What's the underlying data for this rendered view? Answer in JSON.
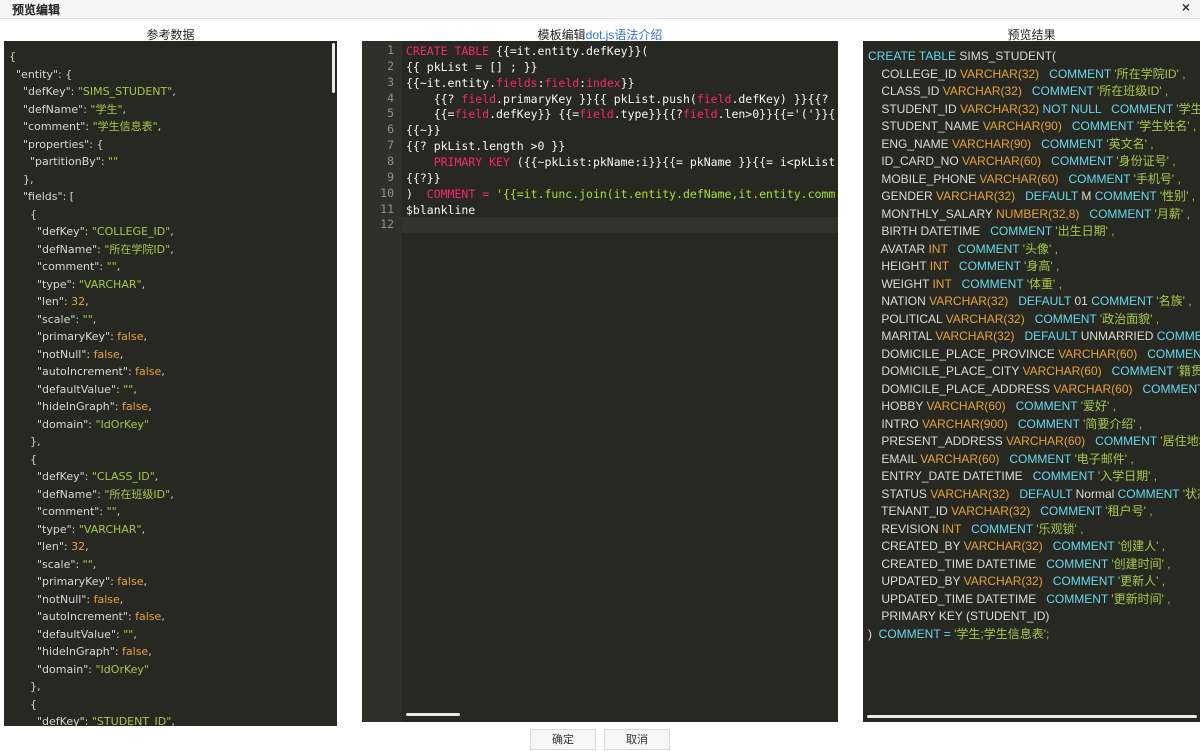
{
  "dialog": {
    "title": "预览编辑",
    "close": "×"
  },
  "columns": {
    "reference": "参考数据",
    "template_prefix": "模板编辑",
    "template_link": "dot.js语法介绍",
    "preview": "预览结果"
  },
  "buttons": {
    "ok": "确定",
    "cancel": "取消"
  },
  "reference_json": [
    [
      [
        "p",
        "{"
      ]
    ],
    [
      [
        "k",
        "  \"entity\""
      ],
      [
        "p",
        ": {"
      ]
    ],
    [
      [
        "k",
        "    \"defKey\""
      ],
      [
        "p",
        ": "
      ],
      [
        "s",
        "\"SIMS_STUDENT\""
      ],
      [
        "p",
        ","
      ]
    ],
    [
      [
        "k",
        "    \"defName\""
      ],
      [
        "p",
        ": "
      ],
      [
        "s",
        "\"学生\""
      ],
      [
        "p",
        ","
      ]
    ],
    [
      [
        "k",
        "    \"comment\""
      ],
      [
        "p",
        ": "
      ],
      [
        "s",
        "\"学生信息表\""
      ],
      [
        "p",
        ","
      ]
    ],
    [
      [
        "k",
        "    \"properties\""
      ],
      [
        "p",
        ": {"
      ]
    ],
    [
      [
        "k",
        "      \"partitionBy\""
      ],
      [
        "p",
        ": "
      ],
      [
        "s",
        "\"\""
      ]
    ],
    [
      [
        "p",
        "    },"
      ]
    ],
    [
      [
        "k",
        "    \"fields\""
      ],
      [
        "p",
        ": ["
      ]
    ],
    [
      [
        "p",
        "      {"
      ]
    ],
    [
      [
        "k",
        "        \"defKey\""
      ],
      [
        "p",
        ": "
      ],
      [
        "s",
        "\"COLLEGE_ID\""
      ],
      [
        "p",
        ","
      ]
    ],
    [
      [
        "k",
        "        \"defName\""
      ],
      [
        "p",
        ": "
      ],
      [
        "s",
        "\"所在学院ID\""
      ],
      [
        "p",
        ","
      ]
    ],
    [
      [
        "k",
        "        \"comment\""
      ],
      [
        "p",
        ": "
      ],
      [
        "s",
        "\"\""
      ],
      [
        "p",
        ","
      ]
    ],
    [
      [
        "k",
        "        \"type\""
      ],
      [
        "p",
        ": "
      ],
      [
        "s",
        "\"VARCHAR\""
      ],
      [
        "p",
        ","
      ]
    ],
    [
      [
        "k",
        "        \"len\""
      ],
      [
        "p",
        ": "
      ],
      [
        "n",
        "32"
      ],
      [
        "p",
        ","
      ]
    ],
    [
      [
        "k",
        "        \"scale\""
      ],
      [
        "p",
        ": "
      ],
      [
        "s",
        "\"\""
      ],
      [
        "p",
        ","
      ]
    ],
    [
      [
        "k",
        "        \"primaryKey\""
      ],
      [
        "p",
        ": "
      ],
      [
        "b",
        "false"
      ],
      [
        "p",
        ","
      ]
    ],
    [
      [
        "k",
        "        \"notNull\""
      ],
      [
        "p",
        ": "
      ],
      [
        "b",
        "false"
      ],
      [
        "p",
        ","
      ]
    ],
    [
      [
        "k",
        "        \"autoIncrement\""
      ],
      [
        "p",
        ": "
      ],
      [
        "b",
        "false"
      ],
      [
        "p",
        ","
      ]
    ],
    [
      [
        "k",
        "        \"defaultValue\""
      ],
      [
        "p",
        ": "
      ],
      [
        "s",
        "\"\""
      ],
      [
        "p",
        ","
      ]
    ],
    [
      [
        "k",
        "        \"hideInGraph\""
      ],
      [
        "p",
        ": "
      ],
      [
        "b",
        "false"
      ],
      [
        "p",
        ","
      ]
    ],
    [
      [
        "k",
        "        \"domain\""
      ],
      [
        "p",
        ": "
      ],
      [
        "s",
        "\"IdOrKey\""
      ]
    ],
    [
      [
        "p",
        "      },"
      ]
    ],
    [
      [
        "p",
        "      {"
      ]
    ],
    [
      [
        "k",
        "        \"defKey\""
      ],
      [
        "p",
        ": "
      ],
      [
        "s",
        "\"CLASS_ID\""
      ],
      [
        "p",
        ","
      ]
    ],
    [
      [
        "k",
        "        \"defName\""
      ],
      [
        "p",
        ": "
      ],
      [
        "s",
        "\"所在班级ID\""
      ],
      [
        "p",
        ","
      ]
    ],
    [
      [
        "k",
        "        \"comment\""
      ],
      [
        "p",
        ": "
      ],
      [
        "s",
        "\"\""
      ],
      [
        "p",
        ","
      ]
    ],
    [
      [
        "k",
        "        \"type\""
      ],
      [
        "p",
        ": "
      ],
      [
        "s",
        "\"VARCHAR\""
      ],
      [
        "p",
        ","
      ]
    ],
    [
      [
        "k",
        "        \"len\""
      ],
      [
        "p",
        ": "
      ],
      [
        "n",
        "32"
      ],
      [
        "p",
        ","
      ]
    ],
    [
      [
        "k",
        "        \"scale\""
      ],
      [
        "p",
        ": "
      ],
      [
        "s",
        "\"\""
      ],
      [
        "p",
        ","
      ]
    ],
    [
      [
        "k",
        "        \"primaryKey\""
      ],
      [
        "p",
        ": "
      ],
      [
        "b",
        "false"
      ],
      [
        "p",
        ","
      ]
    ],
    [
      [
        "k",
        "        \"notNull\""
      ],
      [
        "p",
        ": "
      ],
      [
        "b",
        "false"
      ],
      [
        "p",
        ","
      ]
    ],
    [
      [
        "k",
        "        \"autoIncrement\""
      ],
      [
        "p",
        ": "
      ],
      [
        "b",
        "false"
      ],
      [
        "p",
        ","
      ]
    ],
    [
      [
        "k",
        "        \"defaultValue\""
      ],
      [
        "p",
        ": "
      ],
      [
        "s",
        "\"\""
      ],
      [
        "p",
        ","
      ]
    ],
    [
      [
        "k",
        "        \"hideInGraph\""
      ],
      [
        "p",
        ": "
      ],
      [
        "b",
        "false"
      ],
      [
        "p",
        ","
      ]
    ],
    [
      [
        "k",
        "        \"domain\""
      ],
      [
        "p",
        ": "
      ],
      [
        "s",
        "\"IdOrKey\""
      ]
    ],
    [
      [
        "p",
        "      },"
      ]
    ],
    [
      [
        "p",
        "      {"
      ]
    ],
    [
      [
        "k",
        "        \"defKey\""
      ],
      [
        "p",
        ": "
      ],
      [
        "s",
        "\"STUDENT_ID\""
      ],
      [
        "p",
        ","
      ]
    ]
  ],
  "template_lines": [
    {
      "n": "1",
      "tokens": [
        [
          "kw",
          "CREATE TABLE "
        ],
        [
          "kk",
          "{{=it.entity.defKey}}("
        ]
      ]
    },
    {
      "n": "2",
      "tokens": [
        [
          "kk",
          "{{ pkList = [] ; }}"
        ]
      ]
    },
    {
      "n": "3",
      "tokens": [
        [
          "kk",
          "{{~it.entity."
        ],
        [
          "kw",
          "fields"
        ],
        [
          "kk",
          ":"
        ],
        [
          "kw",
          "field"
        ],
        [
          "kk",
          ":"
        ],
        [
          "kw",
          "index"
        ],
        [
          "kk",
          "}}"
        ]
      ]
    },
    {
      "n": "4",
      "tokens": [
        [
          "kk",
          "    {{? "
        ],
        [
          "kw",
          "field"
        ],
        [
          "kk",
          ".primaryKey }}{{ pkList.push("
        ],
        [
          "kw",
          "field"
        ],
        [
          "kk",
          ".defKey) }}{{?"
        ]
      ]
    },
    {
      "n": "5",
      "tokens": [
        [
          "kk",
          "    {{="
        ],
        [
          "kw",
          "field"
        ],
        [
          "kk",
          ".defKey}} {{="
        ],
        [
          "kw",
          "field"
        ],
        [
          "kk",
          ".type}}{{?"
        ],
        [
          "kw",
          "field"
        ],
        [
          "kk",
          ".len>0}}{{='('}}{"
        ]
      ]
    },
    {
      "n": "6",
      "tokens": [
        [
          "kk",
          "{{~}}"
        ]
      ]
    },
    {
      "n": "7",
      "tokens": [
        [
          "kk",
          "{{? pkList.length >0 }}"
        ]
      ]
    },
    {
      "n": "8",
      "tokens": [
        [
          "kw",
          "    PRIMARY KEY "
        ],
        [
          "kk",
          "({{~pkList:pkName:i}}{{= pkName }}{{= i<pkList"
        ]
      ]
    },
    {
      "n": "9",
      "tokens": [
        [
          "kk",
          "{{?}}"
        ]
      ]
    },
    {
      "n": "10",
      "tokens": [
        [
          "kk",
          ")  "
        ],
        [
          "kw",
          "COMMENT = "
        ],
        [
          "fn",
          "'{{=it.func.join(it.entity.defName,it.entity.comm"
        ]
      ]
    },
    {
      "n": "11",
      "tokens": [
        [
          "kk",
          "$blankline"
        ]
      ]
    },
    {
      "n": "12",
      "tokens": []
    }
  ],
  "preview_lines": [
    [
      [
        "kwp",
        "CREATE TABLE "
      ],
      [
        "col",
        "SIMS_STUDENT("
      ]
    ],
    [
      [
        "col",
        "    COLLEGE_ID "
      ],
      [
        "typ",
        "VARCHAR(32)"
      ],
      [
        "kwp",
        "   COMMENT "
      ],
      [
        "cmt",
        "'所在学院ID' ,"
      ]
    ],
    [
      [
        "col",
        "    CLASS_ID "
      ],
      [
        "typ",
        "VARCHAR(32)"
      ],
      [
        "kwp",
        "   COMMENT "
      ],
      [
        "cmt",
        "'所在班级ID' ,"
      ]
    ],
    [
      [
        "col",
        "    STUDENT_ID "
      ],
      [
        "typ",
        "VARCHAR(32)"
      ],
      [
        "kwp",
        " NOT NULL"
      ],
      [
        "kwp",
        "   COMMENT "
      ],
      [
        "cmt",
        "'学生ID"
      ]
    ],
    [
      [
        "col",
        "    STUDENT_NAME "
      ],
      [
        "typ",
        "VARCHAR(90)"
      ],
      [
        "kwp",
        "   COMMENT "
      ],
      [
        "cmt",
        "'学生姓名' ,"
      ]
    ],
    [
      [
        "col",
        "    ENG_NAME "
      ],
      [
        "typ",
        "VARCHAR(90)"
      ],
      [
        "kwp",
        "   COMMENT "
      ],
      [
        "cmt",
        "'英文名' ,"
      ]
    ],
    [
      [
        "col",
        "    ID_CARD_NO "
      ],
      [
        "typ",
        "VARCHAR(60)"
      ],
      [
        "kwp",
        "   COMMENT "
      ],
      [
        "cmt",
        "'身份证号' ,"
      ]
    ],
    [
      [
        "col",
        "    MOBILE_PHONE "
      ],
      [
        "typ",
        "VARCHAR(60)"
      ],
      [
        "kwp",
        "   COMMENT "
      ],
      [
        "cmt",
        "'手机号' ,"
      ]
    ],
    [
      [
        "col",
        "    GENDER "
      ],
      [
        "typ",
        "VARCHAR(32)"
      ],
      [
        "kwp",
        "   DEFAULT "
      ],
      [
        "col",
        "M "
      ],
      [
        "kwp",
        "COMMENT "
      ],
      [
        "cmt",
        "'性别' ,"
      ]
    ],
    [
      [
        "col",
        "    MONTHLY_SALARY "
      ],
      [
        "typ",
        "NUMBER(32,8)"
      ],
      [
        "kwp",
        "   COMMENT "
      ],
      [
        "cmt",
        "'月薪' ,"
      ]
    ],
    [
      [
        "col",
        "    BIRTH DATETIME"
      ],
      [
        "kwp",
        "   COMMENT "
      ],
      [
        "cmt",
        "'出生日期' ,"
      ]
    ],
    [
      [
        "col",
        "    AVATAR "
      ],
      [
        "typ",
        "INT"
      ],
      [
        "kwp",
        "   COMMENT "
      ],
      [
        "cmt",
        "'头像' ,"
      ]
    ],
    [
      [
        "col",
        "    HEIGHT "
      ],
      [
        "typ",
        "INT"
      ],
      [
        "kwp",
        "   COMMENT "
      ],
      [
        "cmt",
        "'身高' ,"
      ]
    ],
    [
      [
        "col",
        "    WEIGHT "
      ],
      [
        "typ",
        "INT"
      ],
      [
        "kwp",
        "   COMMENT "
      ],
      [
        "cmt",
        "'体重' ,"
      ]
    ],
    [
      [
        "col",
        "    NATION "
      ],
      [
        "typ",
        "VARCHAR(32)"
      ],
      [
        "kwp",
        "   DEFAULT "
      ],
      [
        "col",
        "01 "
      ],
      [
        "kwp",
        "COMMENT "
      ],
      [
        "cmt",
        "'名族' ,"
      ]
    ],
    [
      [
        "col",
        "    POLITICAL "
      ],
      [
        "typ",
        "VARCHAR(32)"
      ],
      [
        "kwp",
        "   COMMENT "
      ],
      [
        "cmt",
        "'政治面貌' ,"
      ]
    ],
    [
      [
        "col",
        "    MARITAL "
      ],
      [
        "typ",
        "VARCHAR(32)"
      ],
      [
        "kwp",
        "   DEFAULT "
      ],
      [
        "col",
        "UNMARRIED "
      ],
      [
        "kwp",
        "COMMENT"
      ]
    ],
    [
      [
        "col",
        "    DOMICILE_PLACE_PROVINCE "
      ],
      [
        "typ",
        "VARCHAR(60)"
      ],
      [
        "kwp",
        "   COMMENT "
      ],
      [
        "cmt",
        "'"
      ]
    ],
    [
      [
        "col",
        "    DOMICILE_PLACE_CITY "
      ],
      [
        "typ",
        "VARCHAR(60)"
      ],
      [
        "kwp",
        "   COMMENT "
      ],
      [
        "cmt",
        "'籍贯"
      ]
    ],
    [
      [
        "col",
        "    DOMICILE_PLACE_ADDRESS "
      ],
      [
        "typ",
        "VARCHAR(60)"
      ],
      [
        "kwp",
        "   COMMENT "
      ],
      [
        "cmt",
        "'"
      ]
    ],
    [
      [
        "col",
        "    HOBBY "
      ],
      [
        "typ",
        "VARCHAR(60)"
      ],
      [
        "kwp",
        "   COMMENT "
      ],
      [
        "cmt",
        "'爱好' ,"
      ]
    ],
    [
      [
        "col",
        "    INTRO "
      ],
      [
        "typ",
        "VARCHAR(900)"
      ],
      [
        "kwp",
        "   COMMENT "
      ],
      [
        "cmt",
        "'简要介绍' ,"
      ]
    ],
    [
      [
        "col",
        "    PRESENT_ADDRESS "
      ],
      [
        "typ",
        "VARCHAR(60)"
      ],
      [
        "kwp",
        "   COMMENT "
      ],
      [
        "cmt",
        "'居住地址'"
      ]
    ],
    [
      [
        "col",
        "    EMAIL "
      ],
      [
        "typ",
        "VARCHAR(60)"
      ],
      [
        "kwp",
        "   COMMENT "
      ],
      [
        "cmt",
        "'电子邮件' ,"
      ]
    ],
    [
      [
        "col",
        "    ENTRY_DATE DATETIME"
      ],
      [
        "kwp",
        "   COMMENT "
      ],
      [
        "cmt",
        "'入学日期' ,"
      ]
    ],
    [
      [
        "col",
        "    STATUS "
      ],
      [
        "typ",
        "VARCHAR(32)"
      ],
      [
        "kwp",
        "   DEFAULT "
      ],
      [
        "col",
        "Normal "
      ],
      [
        "kwp",
        "COMMENT "
      ],
      [
        "cmt",
        "'状态"
      ]
    ],
    [
      [
        "col",
        "    TENANT_ID "
      ],
      [
        "typ",
        "VARCHAR(32)"
      ],
      [
        "kwp",
        "   COMMENT "
      ],
      [
        "cmt",
        "'租户号' ,"
      ]
    ],
    [
      [
        "col",
        "    REVISION "
      ],
      [
        "typ",
        "INT"
      ],
      [
        "kwp",
        "   COMMENT "
      ],
      [
        "cmt",
        "'乐观锁' ,"
      ]
    ],
    [
      [
        "col",
        "    CREATED_BY "
      ],
      [
        "typ",
        "VARCHAR(32)"
      ],
      [
        "kwp",
        "   COMMENT "
      ],
      [
        "cmt",
        "'创建人' ,"
      ]
    ],
    [
      [
        "col",
        "    CREATED_TIME DATETIME"
      ],
      [
        "kwp",
        "   COMMENT "
      ],
      [
        "cmt",
        "'创建时间' ,"
      ]
    ],
    [
      [
        "col",
        "    UPDATED_BY "
      ],
      [
        "typ",
        "VARCHAR(32)"
      ],
      [
        "kwp",
        "   COMMENT "
      ],
      [
        "cmt",
        "'更新人' ,"
      ]
    ],
    [
      [
        "col",
        "    UPDATED_TIME DATETIME"
      ],
      [
        "kwp",
        "   COMMENT "
      ],
      [
        "cmt",
        "'更新时间' ,"
      ]
    ],
    [
      [
        "col",
        "    PRIMARY KEY (STUDENT_ID)"
      ]
    ],
    [
      [
        "col",
        ")  "
      ],
      [
        "kwp",
        "COMMENT = "
      ],
      [
        "cmt",
        "'学生;学生信息表';"
      ]
    ]
  ]
}
